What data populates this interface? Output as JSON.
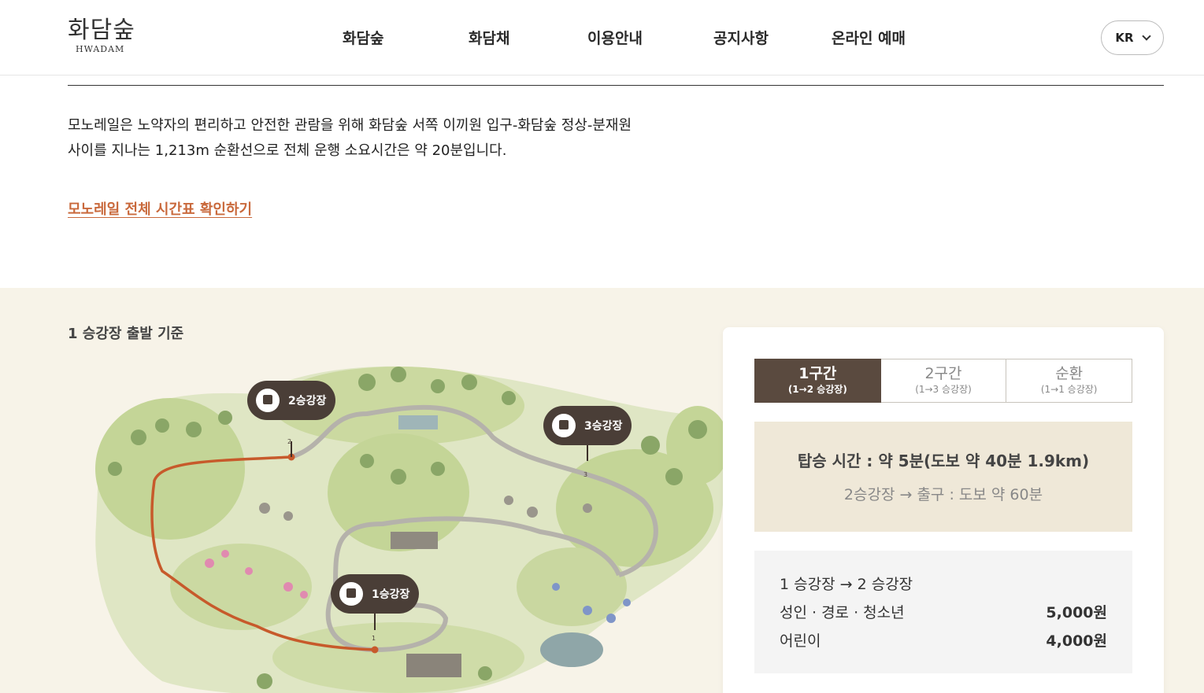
{
  "header": {
    "logo_ko": "화담숲",
    "logo_en": "HWADAM",
    "nav": [
      "화담숲",
      "화담채",
      "이용안내",
      "공지사항",
      "온라인 예매"
    ],
    "lang": "KR"
  },
  "intro": {
    "line1": "모노레일은 노약자의 편리하고 안전한 관람을 위해 화담숲 서쪽 이끼원 입구-화담숲 정상-분재원",
    "line2": "사이를 지나는 1,213m 순환선으로 전체 운행 소요시간은 약 20분입니다.",
    "link": "모노레일 전체 시간표 확인하기"
  },
  "map": {
    "label": "1 승강장 출발 기준",
    "stations": [
      "1승강장",
      "2승강장",
      "3승강장"
    ],
    "station_markers": [
      "1",
      "2",
      "3"
    ]
  },
  "card": {
    "tabs": [
      {
        "title": "1구간",
        "sub": "(1→2 승강장)"
      },
      {
        "title": "2구간",
        "sub": "(1→3 승강장)"
      },
      {
        "title": "순환",
        "sub": "(1→1 승강장)"
      }
    ],
    "ride_time": "탑승 시간 : 약 5분(도보 약 40분 1.9km)",
    "walk_from": "2승강장",
    "walk_to": "출구 : 도보 약 60분",
    "fare_from": "1 승강장",
    "fare_to": "2 승강장",
    "fares": [
      {
        "label": "성인 · 경로 · 청소년",
        "value": "5,000원"
      },
      {
        "label": "어린이",
        "value": "4,000원"
      }
    ]
  },
  "colors": {
    "accent": "#c9693c",
    "brown": "#5a4a3f",
    "section_bg": "#f7f3e8",
    "map_green": "#c9d8a0",
    "track_gray": "#b5b2ab",
    "route_orange": "#c75a2b"
  }
}
